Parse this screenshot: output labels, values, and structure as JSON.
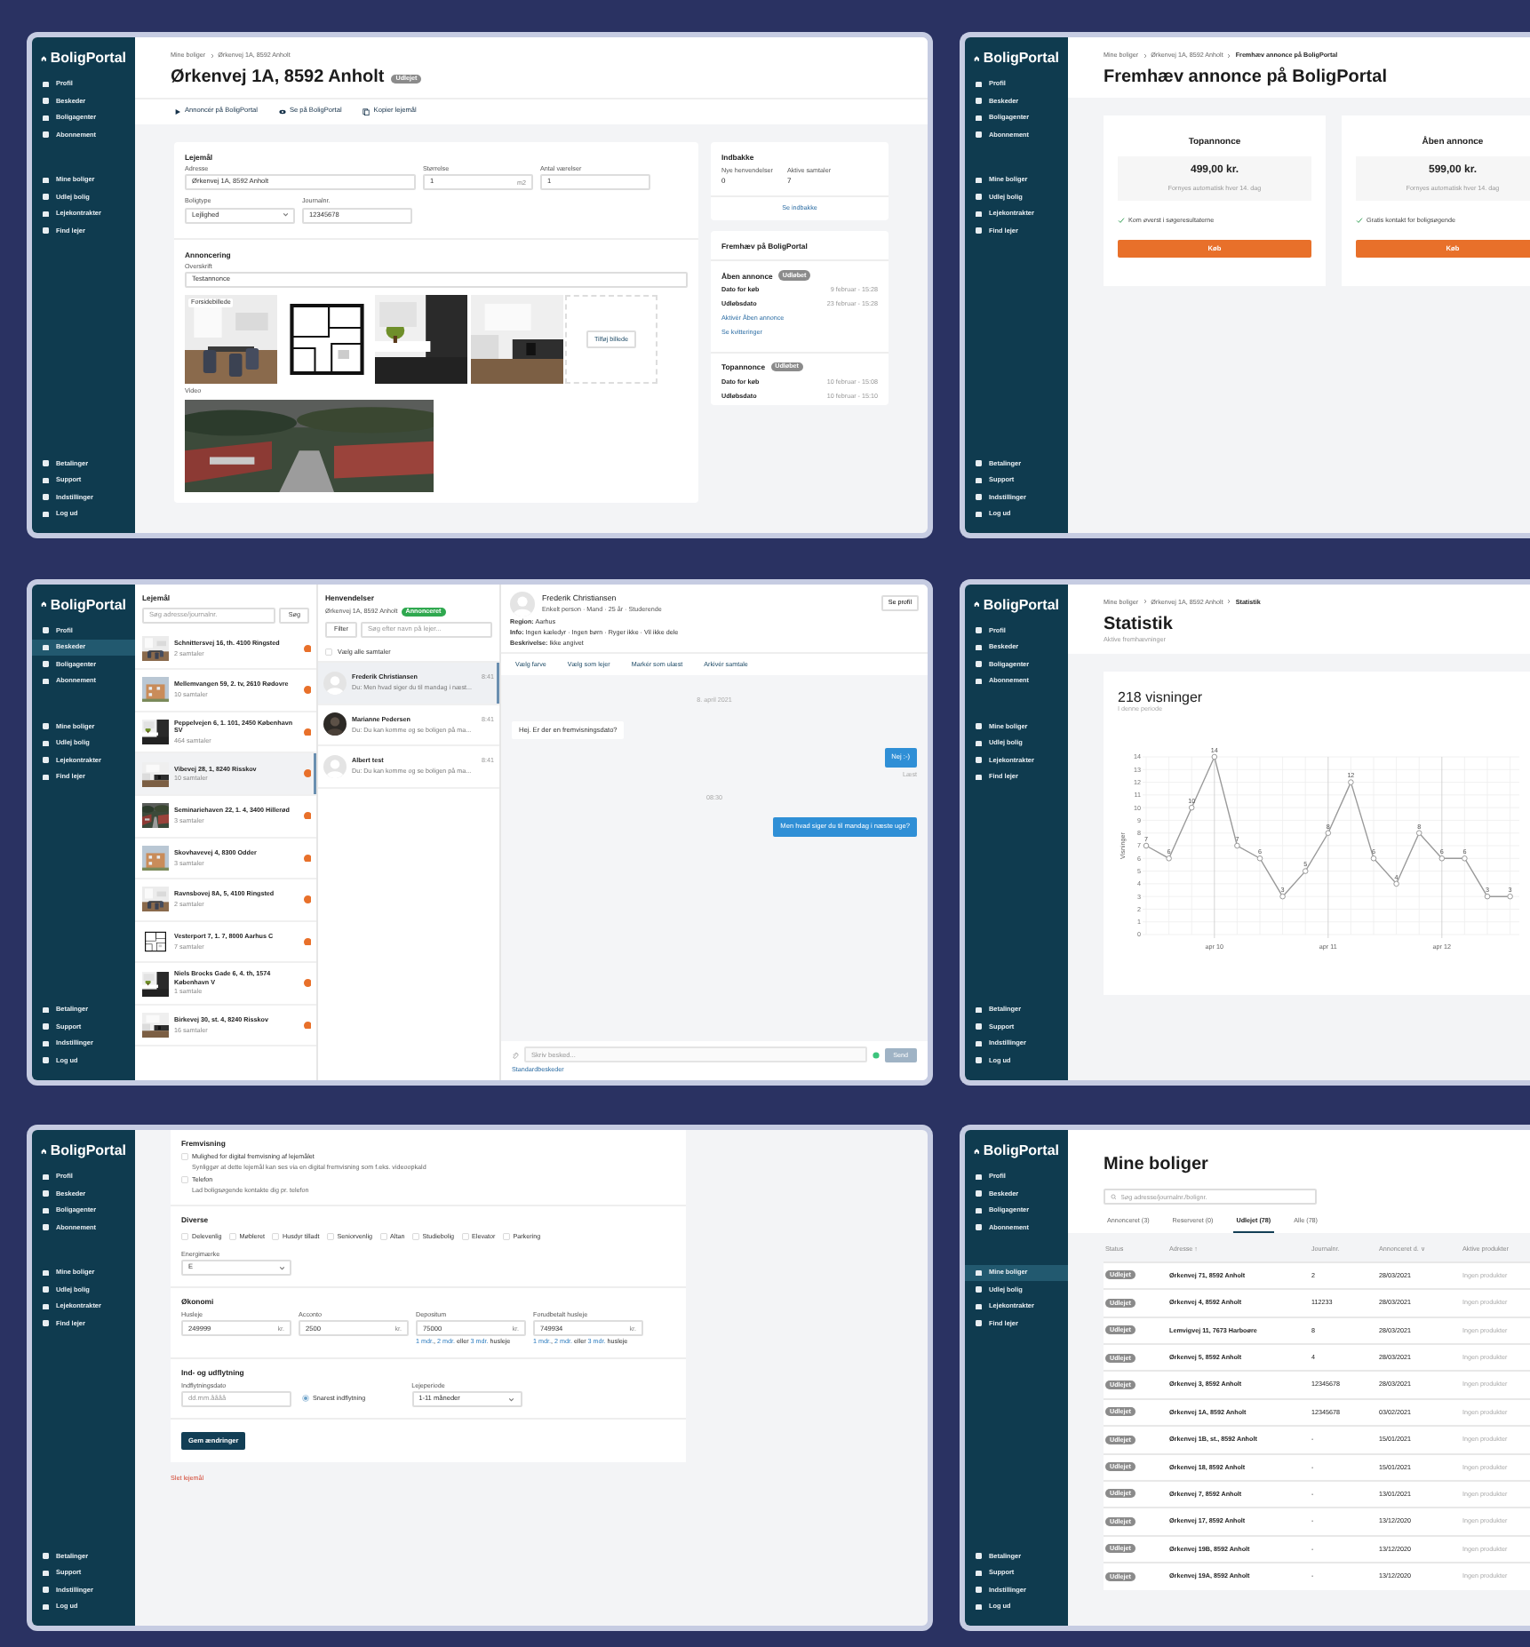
{
  "panels": [
    {
      "kind": "property",
      "sidebar": {
        "logo": "BoligPortal",
        "top": [
          {
            "label": "Profil",
            "selected": false
          },
          {
            "label": "Beskeder",
            "selected": false
          },
          {
            "label": "Boligagenter",
            "selected": false
          },
          {
            "label": "Abonnement",
            "selected": false
          }
        ],
        "middle": [
          {
            "label": "Mine boliger",
            "selected": false
          },
          {
            "label": "Udlej bolig",
            "selected": false
          },
          {
            "label": "Lejekontrakter",
            "selected": false
          },
          {
            "label": "Find lejer",
            "selected": false
          }
        ],
        "bottom": [
          {
            "label": "Betalinger",
            "selected": false
          },
          {
            "label": "Support",
            "selected": false
          },
          {
            "label": "Indstillinger",
            "selected": false
          },
          {
            "label": "Log ud",
            "selected": false
          }
        ]
      },
      "breadcrumb": [
        "Mine boliger",
        "Ørkenvej 1A, 8592 Anholt"
      ],
      "title": "Ørkenvej 1A, 8592 Anholt",
      "badge": "Udlejet",
      "actions": [
        "Annoncér på BoligPortal",
        "Se på BoligPortal",
        "Kopier lejemål"
      ],
      "lease": {
        "heading": "Lejemål",
        "rows": [
          [
            {
              "kind": "text",
              "label": "Adresse",
              "value": "Ørkenvej 1A, 8592 Anholt"
            },
            {
              "kind": "text",
              "label": "Størrelse",
              "value": "1",
              "unit": "m2"
            },
            {
              "kind": "text",
              "label": "Antal værelser",
              "value": "1"
            }
          ],
          [
            {
              "kind": "select",
              "label": "Boligtype",
              "value": "Lejlighed"
            },
            {
              "kind": "text",
              "label": "Journalnr.",
              "value": "12345678"
            }
          ]
        ]
      },
      "ad": {
        "heading": "Annoncering",
        "label": "Overskrift",
        "value": "Testannonce",
        "photos": [
          {
            "kind": "picture",
            "tag": "Forsidebillede"
          },
          {
            "kind": "picture"
          },
          {
            "kind": "picture"
          },
          {
            "kind": "picture"
          }
        ],
        "add_photo": "Tilføj billede",
        "video_label": "Video"
      },
      "inbox": {
        "heading": "Indbakke",
        "stats": [
          {
            "label": "Nye henvendelser",
            "value": "0"
          },
          {
            "label": "Aktive samtaler",
            "value": "7"
          }
        ],
        "link": "Se indbakke"
      },
      "promote": {
        "heading": "Fremhæv på BoligPortal",
        "products": [
          {
            "name": "Åben annonce",
            "badge": "Udløbet",
            "rows": [
              {
                "label": "Dato for køb",
                "value": "9 februar - 15:28"
              },
              {
                "label": "Udløbsdato",
                "value": "23 februar - 15:28"
              }
            ],
            "links": [
              "Aktivér Åben annonce",
              "Se kvitteringer"
            ]
          },
          {
            "name": "Topannonce",
            "badge": "Udløbet",
            "rows": [
              {
                "label": "Dato for køb",
                "value": "10 februar - 15:08"
              },
              {
                "label": "Udløbsdato",
                "value": "10 februar - 15:10"
              }
            ]
          }
        ]
      }
    },
    {
      "kind": "promote",
      "sidebar": {
        "logo": "BoligPortal",
        "top": [
          {
            "label": "Profil",
            "selected": false
          },
          {
            "label": "Beskeder",
            "selected": false
          },
          {
            "label": "Boligagenter",
            "selected": false
          },
          {
            "label": "Abonnement",
            "selected": false
          }
        ],
        "middle": [
          {
            "label": "Mine boliger",
            "selected": false
          },
          {
            "label": "Udlej bolig",
            "selected": false
          },
          {
            "label": "Lejekontrakter",
            "selected": false
          },
          {
            "label": "Find lejer",
            "selected": false
          }
        ],
        "bottom": [
          {
            "label": "Betalinger",
            "selected": false
          },
          {
            "label": "Support",
            "selected": false
          },
          {
            "label": "Indstillinger",
            "selected": false
          },
          {
            "label": "Log ud",
            "selected": false
          }
        ]
      },
      "breadcrumb": [
        "Mine boliger",
        "Ørkenvej 1A, 8592 Anholt",
        "Fremhæv annonce på BoligPortal"
      ],
      "title": "Fremhæv annonce på BoligPortal",
      "offers": [
        {
          "name": "Topannonce",
          "price": "499,00 kr.",
          "note": "Fornyes automatisk hver 14. dag",
          "feature": "Kom øverst i søgeresultaterne",
          "button": "Køb"
        },
        {
          "name": "Åben annonce",
          "price": "599,00 kr.",
          "note": "Fornyes automatisk hver 14. dag",
          "feature": "Gratis kontakt for boligsøgende",
          "button": "Køb"
        }
      ]
    },
    {
      "kind": "messages",
      "sidebar": {
        "logo": "BoligPortal",
        "top": [
          {
            "label": "Profil",
            "selected": false
          },
          {
            "label": "Beskeder",
            "selected": true
          },
          {
            "label": "Boligagenter",
            "selected": false
          },
          {
            "label": "Abonnement",
            "selected": false
          }
        ],
        "middle": [
          {
            "label": "Mine boliger",
            "selected": false
          },
          {
            "label": "Udlej bolig",
            "selected": false
          },
          {
            "label": "Lejekontrakter",
            "selected": false
          },
          {
            "label": "Find lejer",
            "selected": false
          }
        ],
        "bottom": [
          {
            "label": "Betalinger",
            "selected": false
          },
          {
            "label": "Support",
            "selected": false
          },
          {
            "label": "Indstillinger",
            "selected": false
          },
          {
            "label": "Log ud",
            "selected": false
          }
        ]
      },
      "leases": {
        "heading": "Lejemål",
        "search_placeholder": "Søg adresse/journalnr.",
        "search_button": "Søg",
        "items": [
          {
            "address": "Schnittersvej 16, th. 4100 Ringsted",
            "count": "2 samtaler",
            "selected": false
          },
          {
            "address": "Mellemvangen 59, 2. tv, 2610 Rødovre",
            "count": "10 samtaler",
            "selected": false
          },
          {
            "address": "Peppelvejen 6, 1. 101, 2450 København SV",
            "count": "464 samtaler",
            "selected": false
          },
          {
            "address": "Vibevej 28, 1, 8240 Risskov",
            "count": "10 samtaler",
            "selected": true
          },
          {
            "address": "Seminariehaven 22, 1. 4, 3400 Hillerød",
            "count": "3 samtaler",
            "selected": false
          },
          {
            "address": "Skovhavevej 4, 8300 Odder",
            "count": "3 samtaler",
            "selected": false
          },
          {
            "address": "Ravnsbovej 8A, 5, 4100 Ringsted",
            "count": "2 samtaler",
            "selected": false
          },
          {
            "address": "Vesterport 7, 1. 7, 8000 Aarhus C",
            "count": "7 samtaler",
            "selected": false
          },
          {
            "address": "Niels Brocks Gade 6, 4. th, 1574 København V",
            "count": "1 samtale",
            "selected": false
          },
          {
            "address": "Birkevej 30, st. 4, 8240 Risskov",
            "count": "16 samtaler",
            "selected": false
          }
        ]
      },
      "inquiries": {
        "heading": "Henvendelser",
        "address": "Ørkenvej 1A, 8592 Anholt",
        "badge": "Annonceret",
        "filter": "Filter",
        "search_placeholder": "Søg efter navn på lejer...",
        "select_all": {
          "label": "Vælg alle samtaler",
          "checked": false
        },
        "items": [
          {
            "name": "Frederik Christiansen",
            "time": "8:41",
            "preview": "Du: Men hvad siger du til mandag i næst...",
            "selected": true,
            "has_photo": false
          },
          {
            "name": "Marianne Pedersen",
            "time": "8:41",
            "preview": "Du: Du kan komme og se boligen på ma...",
            "selected": false,
            "has_photo": true
          },
          {
            "name": "Albert test",
            "time": "8:41",
            "preview": "Du: Du kan komme og se boligen på ma...",
            "selected": false,
            "has_photo": false
          }
        ]
      },
      "chat": {
        "name": "Frederik Christiansen",
        "subtitle": "Enkelt person · Mand · 25 år · Studerende",
        "profile_button": "Se profil",
        "details": [
          {
            "label": "Region:",
            "value": "Aarhus"
          },
          {
            "label": "Info:",
            "value": "Ingen kæledyr · Ingen børn · Ryger ikke · Vil ikke dele"
          },
          {
            "label": "Beskrivelse:",
            "value": "Ikke angivet"
          }
        ],
        "actions": [
          "Vælg farve",
          "Vælg som lejer",
          "Markér som ulæst",
          "Arkivér samtale"
        ],
        "messages": [
          {
            "kind": "date",
            "text": "8. april 2021"
          },
          {
            "kind": "in",
            "text": "Hej. Er der en fremvisningsdato?"
          },
          {
            "kind": "out",
            "text": "Nej :-)",
            "status": "Læst"
          },
          {
            "kind": "date",
            "text": "08:30"
          },
          {
            "kind": "out",
            "text": "Men hvad siger du til mandag i næste uge?"
          }
        ],
        "input_placeholder": "Skriv besked...",
        "send": "Send",
        "templates": "Standardbeskeder"
      }
    },
    {
      "kind": "statistics",
      "sidebar": {
        "logo": "BoligPortal",
        "top": [
          {
            "label": "Profil",
            "selected": false
          },
          {
            "label": "Beskeder",
            "selected": false
          },
          {
            "label": "Boligagenter",
            "selected": false
          },
          {
            "label": "Abonnement",
            "selected": false
          }
        ],
        "middle": [
          {
            "label": "Mine boliger",
            "selected": false
          },
          {
            "label": "Udlej bolig",
            "selected": false
          },
          {
            "label": "Lejekontrakter",
            "selected": false
          },
          {
            "label": "Find lejer",
            "selected": false
          }
        ],
        "bottom": [
          {
            "label": "Betalinger",
            "selected": false
          },
          {
            "label": "Support",
            "selected": false
          },
          {
            "label": "Indstillinger",
            "selected": false
          },
          {
            "label": "Log ud",
            "selected": false
          }
        ]
      },
      "breadcrumb": [
        "Mine boliger",
        "Ørkenvej 1A, 8592 Anholt",
        "Statistik"
      ],
      "title": "Statistik",
      "subtitle": "Aktive fremhævninger",
      "card": {
        "heading": "218 visninger",
        "caption": "I denne periode",
        "chart_data": {
          "type": "line",
          "ylabel": "Visninger",
          "categories": [
            null,
            null,
            null,
            "apr 10",
            null,
            null,
            null,
            null,
            "apr 11",
            null,
            null,
            null,
            null,
            "apr 12",
            null,
            null,
            null
          ],
          "grid": true,
          "series": [
            {
              "color": "#9a9a9a",
              "marker": "circle",
              "values": [
                7,
                6,
                10,
                14,
                7,
                6,
                3,
                5,
                8,
                12,
                6,
                4,
                8,
                6,
                6,
                3,
                3
              ]
            }
          ],
          "ylim": [
            0,
            14
          ],
          "yticks": [
            0,
            1,
            2,
            3,
            4,
            5,
            6,
            7,
            8,
            9,
            10,
            11,
            12,
            13,
            14
          ],
          "data_labels": true
        }
      }
    },
    {
      "kind": "form",
      "sidebar": {
        "logo": "BoligPortal",
        "top": [
          {
            "label": "Profil",
            "selected": false
          },
          {
            "label": "Beskeder",
            "selected": false
          },
          {
            "label": "Boligagenter",
            "selected": false
          },
          {
            "label": "Abonnement",
            "selected": false
          }
        ],
        "middle": [
          {
            "label": "Mine boliger",
            "selected": false
          },
          {
            "label": "Udlej bolig",
            "selected": false
          },
          {
            "label": "Lejekontrakter",
            "selected": false
          },
          {
            "label": "Find lejer",
            "selected": false
          }
        ],
        "bottom": [
          {
            "label": "Betalinger",
            "selected": false
          },
          {
            "label": "Support",
            "selected": false
          },
          {
            "label": "Indstillinger",
            "selected": false
          },
          {
            "label": "Log ud",
            "selected": false
          }
        ]
      },
      "sections": [
        {
          "kind": "checklist",
          "heading": "Fremvisning",
          "options": [
            {
              "label": "Mulighed for digital fremvisning af lejemålet",
              "hint": "Synliggør at dette lejemål kan ses via en digital fremvisning som f.eks. videoopkald",
              "checked": false
            },
            {
              "label": "Telefon",
              "hint": "Lad boligsøgende kontakte dig pr. telefon",
              "checked": false
            }
          ]
        },
        {
          "kind": "features",
          "heading": "Diverse",
          "options": [
            {
              "label": "Delevenlig",
              "checked": false
            },
            {
              "label": "Møbleret",
              "checked": false
            },
            {
              "label": "Husdyr tilladt",
              "checked": false
            },
            {
              "label": "Seniorvenlig",
              "checked": false
            },
            {
              "label": "Altan",
              "checked": false
            },
            {
              "label": "Studiebolig",
              "checked": false
            },
            {
              "label": "Elevator",
              "checked": false
            },
            {
              "label": "Parkering",
              "checked": false
            }
          ],
          "select": {
            "label": "Energimærke",
            "value": "E"
          }
        },
        {
          "kind": "economy",
          "heading": "Økonomi",
          "fields": [
            {
              "label": "Husleje",
              "value": "249999",
              "unit": "kr."
            },
            {
              "label": "Acconto",
              "value": "2500",
              "unit": "kr."
            },
            {
              "label": "Depositum",
              "value": "75000",
              "unit": "kr.",
              "help": [
                {
                  "text": "1 mdr.",
                  "link": true
                },
                {
                  "text": ", ",
                  "link": false
                },
                {
                  "text": "2 mdr.",
                  "link": true
                },
                {
                  "text": " eller ",
                  "link": false
                },
                {
                  "text": "3 mdr.",
                  "link": true
                },
                {
                  "text": " husleje",
                  "link": false
                }
              ]
            },
            {
              "label": "Forudbetalt husleje",
              "value": "749934",
              "unit": "kr.",
              "help": [
                {
                  "text": "1 mdr.",
                  "link": true
                },
                {
                  "text": ", ",
                  "link": false
                },
                {
                  "text": "2 mdr.",
                  "link": true
                },
                {
                  "text": " eller ",
                  "link": false
                },
                {
                  "text": "3 mdr.",
                  "link": true
                },
                {
                  "text": " husleje",
                  "link": false
                }
              ]
            }
          ]
        },
        {
          "kind": "moving",
          "heading": "Ind- og udflytning",
          "date": {
            "label": "Indflytningsdato",
            "placeholder": "dd.mm.åååå"
          },
          "radio": {
            "label": "Snarest indflytning",
            "selected": true
          },
          "select": {
            "label": "Lejeperiode",
            "value": "1-11 måneder"
          }
        }
      ],
      "save": "Gem ændringer",
      "delete": "Slet lejemål"
    },
    {
      "kind": "list",
      "sidebar": {
        "logo": "BoligPortal",
        "top": [
          {
            "label": "Profil",
            "selected": false
          },
          {
            "label": "Beskeder",
            "selected": false
          },
          {
            "label": "Boligagenter",
            "selected": false
          },
          {
            "label": "Abonnement",
            "selected": false
          }
        ],
        "middle": [
          {
            "label": "Mine boliger",
            "selected": true
          },
          {
            "label": "Udlej bolig",
            "selected": false
          },
          {
            "label": "Lejekontrakter",
            "selected": false
          },
          {
            "label": "Find lejer",
            "selected": false
          }
        ],
        "bottom": [
          {
            "label": "Betalinger",
            "selected": false
          },
          {
            "label": "Support",
            "selected": false
          },
          {
            "label": "Indstillinger",
            "selected": false
          },
          {
            "label": "Log ud",
            "selected": false
          }
        ]
      },
      "title": "Mine boliger",
      "search_placeholder": "Søg adresse/journalnr./bolignr.",
      "tabs": [
        {
          "label": "Annonceret (3)",
          "selected": false
        },
        {
          "label": "Reserveret (0)",
          "selected": false
        },
        {
          "label": "Udlejet (78)",
          "selected": true
        },
        {
          "label": "Alle (78)",
          "selected": false
        }
      ],
      "columns": [
        "Status",
        "Adresse ↑",
        "Journalnr.",
        "Annonceret d. ∨",
        "Aktive produkter"
      ],
      "rows": [
        {
          "status": "Udlejet",
          "address": "Ørkenvej 71, 8592 Anholt",
          "journal": "2",
          "date": "28/03/2021",
          "products": "Ingen produkter"
        },
        {
          "status": "Udlejet",
          "address": "Ørkenvej 4, 8592 Anholt",
          "journal": "112233",
          "date": "28/03/2021",
          "products": "Ingen produkter"
        },
        {
          "status": "Udlejet",
          "address": "Lemvigvej 11, 7673 Harboøre",
          "journal": "8",
          "date": "28/03/2021",
          "products": "Ingen produkter"
        },
        {
          "status": "Udlejet",
          "address": "Ørkenvej 5, 8592 Anholt",
          "journal": "4",
          "date": "28/03/2021",
          "products": "Ingen produkter"
        },
        {
          "status": "Udlejet",
          "address": "Ørkenvej 3, 8592 Anholt",
          "journal": "12345678",
          "date": "28/03/2021",
          "products": "Ingen produkter"
        },
        {
          "status": "Udlejet",
          "address": "Ørkenvej 1A, 8592 Anholt",
          "journal": "12345678",
          "date": "03/02/2021",
          "products": "Ingen produkter"
        },
        {
          "status": "Udlejet",
          "address": "Ørkenvej 1B, st., 8592 Anholt",
          "journal": "-",
          "date": "15/01/2021",
          "products": "Ingen produkter"
        },
        {
          "status": "Udlejet",
          "address": "Ørkenvej 18, 8592 Anholt",
          "journal": "-",
          "date": "15/01/2021",
          "products": "Ingen produkter"
        },
        {
          "status": "Udlejet",
          "address": "Ørkenvej 7, 8592 Anholt",
          "journal": "-",
          "date": "13/01/2021",
          "products": "Ingen produkter"
        },
        {
          "status": "Udlejet",
          "address": "Ørkenvej 17, 8592 Anholt",
          "journal": "-",
          "date": "13/12/2020",
          "products": "Ingen produkter"
        },
        {
          "status": "Udlejet",
          "address": "Ørkenvej 19B, 8592 Anholt",
          "journal": "-",
          "date": "13/12/2020",
          "products": "Ingen produkter"
        },
        {
          "status": "Udlejet",
          "address": "Ørkenvej 19A, 8592 Anholt",
          "journal": "-",
          "date": "13/12/2020",
          "products": "Ingen produkter"
        }
      ]
    }
  ]
}
